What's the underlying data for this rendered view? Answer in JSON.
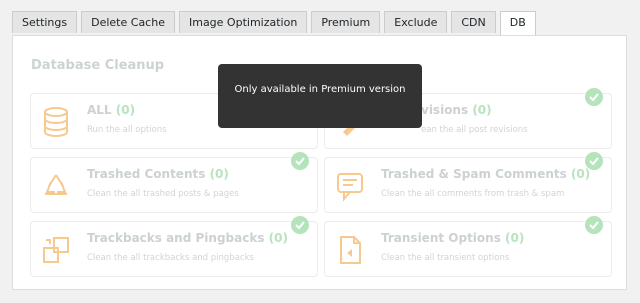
{
  "tabs": [
    {
      "label": "Settings",
      "active": false
    },
    {
      "label": "Delete Cache",
      "active": false
    },
    {
      "label": "Image Optimization",
      "active": false
    },
    {
      "label": "Premium",
      "active": false
    },
    {
      "label": "Exclude",
      "active": false
    },
    {
      "label": "CDN",
      "active": false
    },
    {
      "label": "DB",
      "active": true
    }
  ],
  "panel": {
    "title": "Database Cleanup",
    "overlay_text": "Only available in Premium version"
  },
  "cards": [
    {
      "title": "ALL",
      "count": "(0)",
      "desc": "Run the all options",
      "icon": "database-icon",
      "checked": false
    },
    {
      "title": "Post Revisions",
      "title_visible": "visions",
      "count": "(0)",
      "desc": "Clean the all post revisions",
      "desc_visible": "ean the all post revisions",
      "icon": "revisions-icon",
      "checked": true
    },
    {
      "title": "Trashed Contents",
      "count": "(0)",
      "desc": "Clean the all trashed posts & pages",
      "icon": "recycle-icon",
      "checked": true
    },
    {
      "title": "Trashed & Spam Comments",
      "count": "(0)",
      "desc": "Clean the all comments from trash & spam",
      "icon": "comment-icon",
      "checked": true
    },
    {
      "title": "Trackbacks and Pingbacks",
      "count": "(0)",
      "desc": "Clean the all trackbacks and pingbacks",
      "icon": "trackback-icon",
      "checked": true
    },
    {
      "title": "Transient Options",
      "count": "(0)",
      "desc": "Clean the all transient options",
      "icon": "transient-icon",
      "checked": true
    }
  ],
  "colors": {
    "icon_orange": "#f6c98f",
    "check_green": "#b5e3bb",
    "overlay_bg": "#333333"
  }
}
